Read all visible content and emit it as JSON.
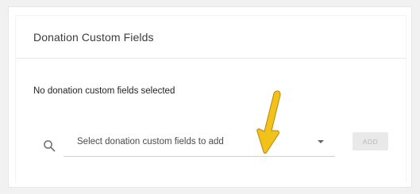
{
  "card": {
    "title": "Donation Custom Fields",
    "empty_message": "No donation custom fields selected"
  },
  "field_select": {
    "placeholder": "Select donation custom fields to add",
    "icon": "search-icon",
    "dropdown_icon": "caret-down-icon"
  },
  "add_button": {
    "label": "ADD",
    "disabled": true
  },
  "annotation": {
    "icon": "arrow-pointer-icon",
    "color": "#f2c21b"
  }
}
